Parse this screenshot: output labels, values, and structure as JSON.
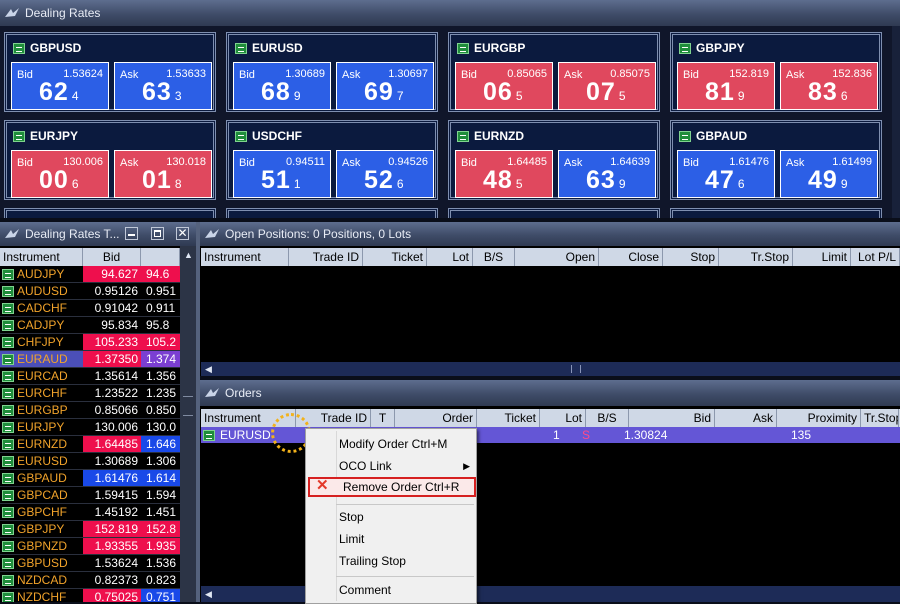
{
  "dealing_rates_window": {
    "title": "Dealing Rates"
  },
  "tiles": [
    {
      "symbol": "GBPUSD",
      "bid": {
        "full": "1.53624",
        "big": "62",
        "pip": "4",
        "color": "#2c5fe6"
      },
      "ask": {
        "full": "1.53633",
        "big": "63",
        "pip": "3",
        "color": "#2c5fe6"
      }
    },
    {
      "symbol": "EURUSD",
      "bid": {
        "full": "1.30689",
        "big": "68",
        "pip": "9",
        "color": "#2c5fe6"
      },
      "ask": {
        "full": "1.30697",
        "big": "69",
        "pip": "7",
        "color": "#2c5fe6"
      }
    },
    {
      "symbol": "EURGBP",
      "bid": {
        "full": "0.85065",
        "big": "06",
        "pip": "5",
        "color": "#e0485e"
      },
      "ask": {
        "full": "0.85075",
        "big": "07",
        "pip": "5",
        "color": "#e0485e"
      }
    },
    {
      "symbol": "GBPJPY",
      "bid": {
        "full": "152.819",
        "big": "81",
        "pip": "9",
        "color": "#e0485e"
      },
      "ask": {
        "full": "152.836",
        "big": "83",
        "pip": "6",
        "color": "#e0485e"
      }
    },
    {
      "symbol": "EURJPY",
      "bid": {
        "full": "130.006",
        "big": "00",
        "pip": "6",
        "color": "#e0485e"
      },
      "ask": {
        "full": "130.018",
        "big": "01",
        "pip": "8",
        "color": "#e0485e"
      }
    },
    {
      "symbol": "USDCHF",
      "bid": {
        "full": "0.94511",
        "big": "51",
        "pip": "1",
        "color": "#2c5fe6"
      },
      "ask": {
        "full": "0.94526",
        "big": "52",
        "pip": "6",
        "color": "#2c5fe6"
      }
    },
    {
      "symbol": "EURNZD",
      "bid": {
        "full": "1.64485",
        "big": "48",
        "pip": "5",
        "color": "#e0485e"
      },
      "ask": {
        "full": "1.64639",
        "big": "63",
        "pip": "9",
        "color": "#2c5fe6"
      }
    },
    {
      "symbol": "GBPAUD",
      "bid": {
        "full": "1.61476",
        "big": "47",
        "pip": "6",
        "color": "#2c5fe6"
      },
      "ask": {
        "full": "1.61499",
        "big": "49",
        "pip": "9",
        "color": "#2c5fe6"
      }
    }
  ],
  "rates_table": {
    "title": "Dealing Rates T...",
    "columns": [
      "Instrument",
      "Bid"
    ],
    "rows": [
      {
        "symbol": "AUDJPY",
        "bid": "94.627",
        "ask": "94.6",
        "bg": "red"
      },
      {
        "symbol": "AUDUSD",
        "bid": "0.95126",
        "ask": "0.951",
        "bg": ""
      },
      {
        "symbol": "CADCHF",
        "bid": "0.91042",
        "ask": "0.911",
        "bg": ""
      },
      {
        "symbol": "CADJPY",
        "bid": "95.834",
        "ask": "95.8",
        "bg": ""
      },
      {
        "symbol": "CHFJPY",
        "bid": "105.233",
        "ask": "105.2",
        "bg": "red"
      },
      {
        "symbol": "EURAUD",
        "bid": "1.37350",
        "ask": "1.374",
        "bg": "purple"
      },
      {
        "symbol": "EURCAD",
        "bid": "1.35614",
        "ask": "1.356",
        "bg": ""
      },
      {
        "symbol": "EURCHF",
        "bid": "1.23522",
        "ask": "1.235",
        "bg": ""
      },
      {
        "symbol": "EURGBP",
        "bid": "0.85066",
        "ask": "0.850",
        "bg": ""
      },
      {
        "symbol": "EURJPY",
        "bid": "130.006",
        "ask": "130.0",
        "bg": ""
      },
      {
        "symbol": "EURNZD",
        "bid": "1.64485",
        "ask": "1.646",
        "bg": "red-blue"
      },
      {
        "symbol": "EURUSD",
        "bid": "1.30689",
        "ask": "1.306",
        "bg": ""
      },
      {
        "symbol": "GBPAUD",
        "bid": "1.61476",
        "ask": "1.614",
        "bg": "blue"
      },
      {
        "symbol": "GBPCAD",
        "bid": "1.59415",
        "ask": "1.594",
        "bg": ""
      },
      {
        "symbol": "GBPCHF",
        "bid": "1.45192",
        "ask": "1.451",
        "bg": ""
      },
      {
        "symbol": "GBPJPY",
        "bid": "152.819",
        "ask": "152.8",
        "bg": "red"
      },
      {
        "symbol": "GBPNZD",
        "bid": "1.93355",
        "ask": "1.935",
        "bg": "red"
      },
      {
        "symbol": "GBPUSD",
        "bid": "1.53624",
        "ask": "1.536",
        "bg": ""
      },
      {
        "symbol": "NZDCAD",
        "bid": "0.82373",
        "ask": "0.823",
        "bg": ""
      },
      {
        "symbol": "NZDCHF",
        "bid": "0.75025",
        "ask": "0.751",
        "bg": "red-blue"
      }
    ]
  },
  "open_positions": {
    "title": "Open Positions: 0 Positions, 0 Lots",
    "columns": [
      "Instrument",
      "Trade ID",
      "Ticket",
      "Lot",
      "B/S",
      "Open",
      "Close",
      "Stop",
      "Tr.Stop",
      "Limit",
      "Lot P/L"
    ]
  },
  "orders": {
    "title": "Orders",
    "columns": [
      "Instrument",
      "Trade ID",
      "T",
      "Order",
      "Ticket",
      "Lot",
      "B/S",
      "Bid",
      "Ask",
      "Proximity",
      "Tr.Stop"
    ],
    "row": {
      "instrument": "EURUSD",
      "lot": "1",
      "bs": "S",
      "bid": "1.30824",
      "proximity": "135"
    }
  },
  "context_menu": {
    "items": [
      {
        "label": "Modify Order  Ctrl+M"
      },
      {
        "label": "OCO Link"
      },
      {
        "label": "Remove Order  Ctrl+R"
      },
      {
        "label": "Stop"
      },
      {
        "label": "Limit"
      },
      {
        "label": "Trailing Stop"
      },
      {
        "label": "Comment"
      }
    ]
  },
  "colors": {
    "bid_red": "#e0485e",
    "bid_blue": "#2c5fe6",
    "highlight": "#d62020",
    "accent_orange": "#f1a32b"
  }
}
